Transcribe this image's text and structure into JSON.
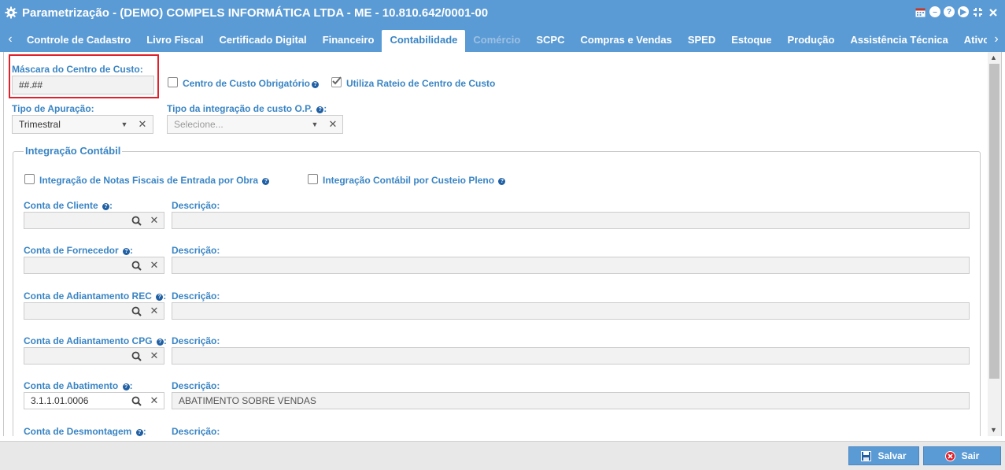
{
  "window": {
    "title": "Parametrização - (DEMO) COMPELS INFORMÁTICA LTDA - ME - 10.810.642/0001-00",
    "icons": [
      "calendar-icon",
      "minimize-icon",
      "help-icon",
      "play-icon",
      "expand-icon",
      "close-icon"
    ]
  },
  "tabs": [
    {
      "label": "Controle de Cadastro",
      "state": "normal"
    },
    {
      "label": "Livro Fiscal",
      "state": "normal"
    },
    {
      "label": "Certificado Digital",
      "state": "normal"
    },
    {
      "label": "Financeiro",
      "state": "normal"
    },
    {
      "label": "Contabilidade",
      "state": "active"
    },
    {
      "label": "Comércio",
      "state": "disabled"
    },
    {
      "label": "SCPC",
      "state": "normal"
    },
    {
      "label": "Compras e Vendas",
      "state": "normal"
    },
    {
      "label": "SPED",
      "state": "normal"
    },
    {
      "label": "Estoque",
      "state": "normal"
    },
    {
      "label": "Produção",
      "state": "normal"
    },
    {
      "label": "Assistência Técnica",
      "state": "normal"
    },
    {
      "label": "Ativo e Imobilizado",
      "state": "normal"
    }
  ],
  "form": {
    "mascara_label": "Máscara do Centro de Custo:",
    "mascara_value": "##.##",
    "centro_obrigatorio_label": "Centro de Custo Obrigatório",
    "centro_obrigatorio_checked": false,
    "rateio_label": "Utiliza Rateio de Centro de Custo",
    "rateio_checked": true,
    "tipo_apuracao_label": "Tipo de Apuração:",
    "tipo_apuracao_value": "Trimestral",
    "tipo_integracao_label": "Tipo da integração de custo O.P.",
    "tipo_integracao_placeholder": "Selecione...",
    "colon": ":"
  },
  "integracao": {
    "legend": "Integração Contábil",
    "notas_obra_label": "Integração de Notas Fiscais de Entrada por Obra",
    "notas_obra_checked": false,
    "custeio_pleno_label": "Integração Contábil por Custeio Pleno",
    "custeio_pleno_checked": false,
    "descricao_label": "Descrição:",
    "contas": [
      {
        "label": "Conta de Cliente",
        "value": "",
        "descricao": ""
      },
      {
        "label": "Conta de Fornecedor",
        "value": "",
        "descricao": ""
      },
      {
        "label": "Conta de Adiantamento REC",
        "value": "",
        "descricao": ""
      },
      {
        "label": "Conta de Adiantamento CPG",
        "value": "",
        "descricao": ""
      },
      {
        "label": "Conta de Abatimento",
        "value": "3.1.1.01.0006",
        "descricao": "ABATIMENTO SOBRE VENDAS"
      },
      {
        "label": "Conta de Desmontagem",
        "value": "",
        "descricao": ""
      }
    ]
  },
  "footer": {
    "salvar_label": "Salvar",
    "sair_label": "Sair"
  },
  "colors": {
    "accent": "#5b9bd5",
    "label": "#3a85c4",
    "highlight": "#e0202a"
  }
}
